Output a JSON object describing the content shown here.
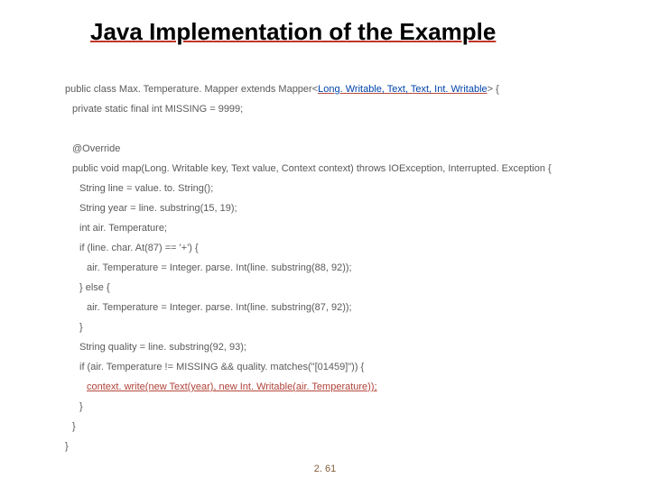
{
  "title": "Java Implementation of the Example",
  "code": {
    "l0a": "public class Max. Temperature. Mapper extends Mapper<",
    "l0b": "Long. Writable, Text, Text, Int. Writable",
    "l0c": "> {",
    "l1": "private static final int MISSING = 9999;",
    "l2": "@Override",
    "l3": "public void map(Long. Writable key, Text value, Context context) throws IOException, Interrupted. Exception {",
    "l4": "String line = value. to. String();",
    "l5": "String year = line. substring(15, 19);",
    "l6": "int air. Temperature;",
    "l7": "if (line. char. At(87) == '+') {",
    "l8": "air. Temperature = Integer. parse. Int(line. substring(88, 92));",
    "l9": "} else {",
    "l10": "air. Temperature = Integer. parse. Int(line. substring(87, 92));",
    "l11": "}",
    "l12": "String quality = line. substring(92, 93);",
    "l13": "if (air. Temperature != MISSING && quality. matches(\"[01459]\")) {",
    "l14": "context. write(new Text(year), new Int. Writable(air. Temperature));",
    "l15": "}",
    "l16": "}",
    "l17": "}"
  },
  "slide_number": "2. 61"
}
